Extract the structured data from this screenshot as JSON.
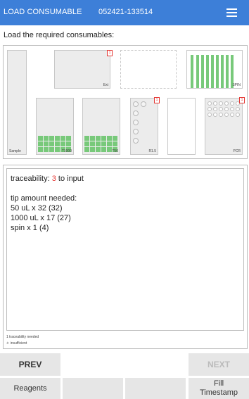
{
  "header": {
    "title": "LOAD CONSUMABLE",
    "run_id": "052421-133514"
  },
  "instruction": "Load the required consumables:",
  "deck": {
    "labels": {
      "sample": "Sample",
      "ext": "Ext",
      "spin": "SPIN",
      "t1000": "T1000",
      "t50": "T50",
      "r15": "R1.5",
      "pcr": "PCR"
    },
    "flag": "1"
  },
  "info": {
    "traceability_label": "traceability:",
    "traceability_count": "3",
    "traceability_suffix": "to input",
    "tip_header": "tip amount needed:",
    "tip_lines": [
      "50 uL x 32 (32)",
      "1000 uL x 17 (27)",
      "spin x 1 (4)"
    ],
    "legend_1": "1 traceability needed",
    "legend_2": "+: insufficient"
  },
  "buttons": {
    "prev": "PREV",
    "next": "NEXT",
    "reagents": "Reagents",
    "fill_timestamp": "Fill\nTimestamp"
  },
  "colors": {
    "header": "#3d7fd8",
    "tip_green": "#78c97a",
    "flag_red": "#e53935"
  }
}
